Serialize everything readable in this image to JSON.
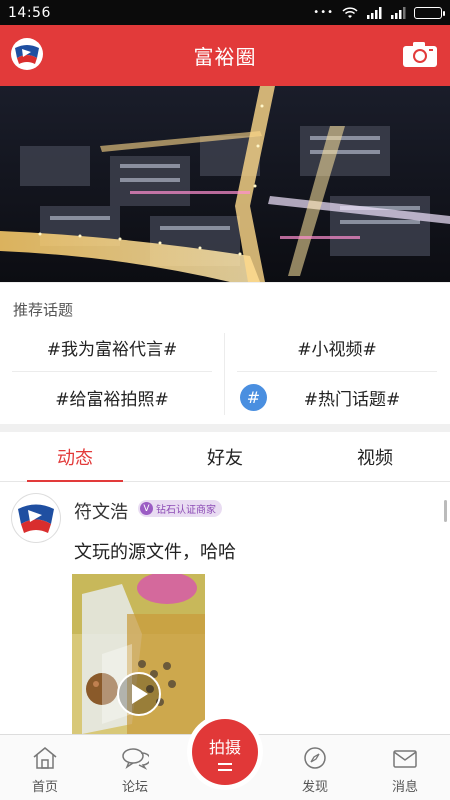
{
  "status_bar": {
    "time": "14:56"
  },
  "header": {
    "title": "富裕圈",
    "logo_icon": "fuyu-logo-icon",
    "camera_icon": "camera-icon",
    "accent": "#e23a3a"
  },
  "banner": {
    "description_icon": "night-city-aerial-image"
  },
  "topics": {
    "heading": "推荐话题",
    "items": [
      {
        "label": "#我为富裕代言#"
      },
      {
        "label": "#小视频#"
      },
      {
        "label": "#给富裕拍照#"
      },
      {
        "label": "#热门话题#",
        "icon": "hash-icon"
      }
    ]
  },
  "tabs": [
    {
      "label": "动态",
      "active": true
    },
    {
      "label": "好友",
      "active": false
    },
    {
      "label": "视频",
      "active": false
    }
  ],
  "post": {
    "username": "符文浩",
    "badge_v": "V",
    "badge": "钻石认证商家",
    "text": "文玩的源文件，哈哈"
  },
  "bottom_nav": {
    "items": [
      {
        "label": "首页",
        "icon": "home-icon"
      },
      {
        "label": "论坛",
        "icon": "forum-icon"
      },
      {
        "label": "发现",
        "icon": "discover-icon"
      },
      {
        "label": "消息",
        "icon": "message-icon"
      }
    ],
    "center_label": "拍摄"
  }
}
